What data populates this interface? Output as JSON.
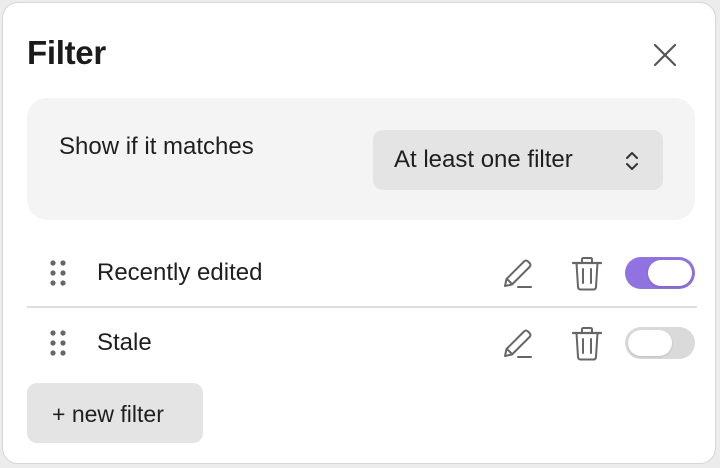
{
  "header": {
    "title": "Filter",
    "close_icon": "close-icon"
  },
  "match": {
    "label": "Show if it matches",
    "select_value": "At least one filter",
    "select_icon": "chevron-up-down-icon"
  },
  "filters": [
    {
      "label": "Recently edited",
      "enabled": true,
      "drag_icon": "drag-handle-icon",
      "edit_icon": "pencil-icon",
      "delete_icon": "trash-icon"
    },
    {
      "label": "Stale",
      "enabled": false,
      "drag_icon": "drag-handle-icon",
      "edit_icon": "pencil-icon",
      "delete_icon": "trash-icon"
    }
  ],
  "footer": {
    "new_filter_label": "+ new filter"
  },
  "colors": {
    "toggle_on": "#9072e0",
    "toggle_off": "#dadada",
    "panel_bg": "#ffffff",
    "match_bg": "#f4f4f4",
    "button_bg": "#e4e4e4"
  }
}
